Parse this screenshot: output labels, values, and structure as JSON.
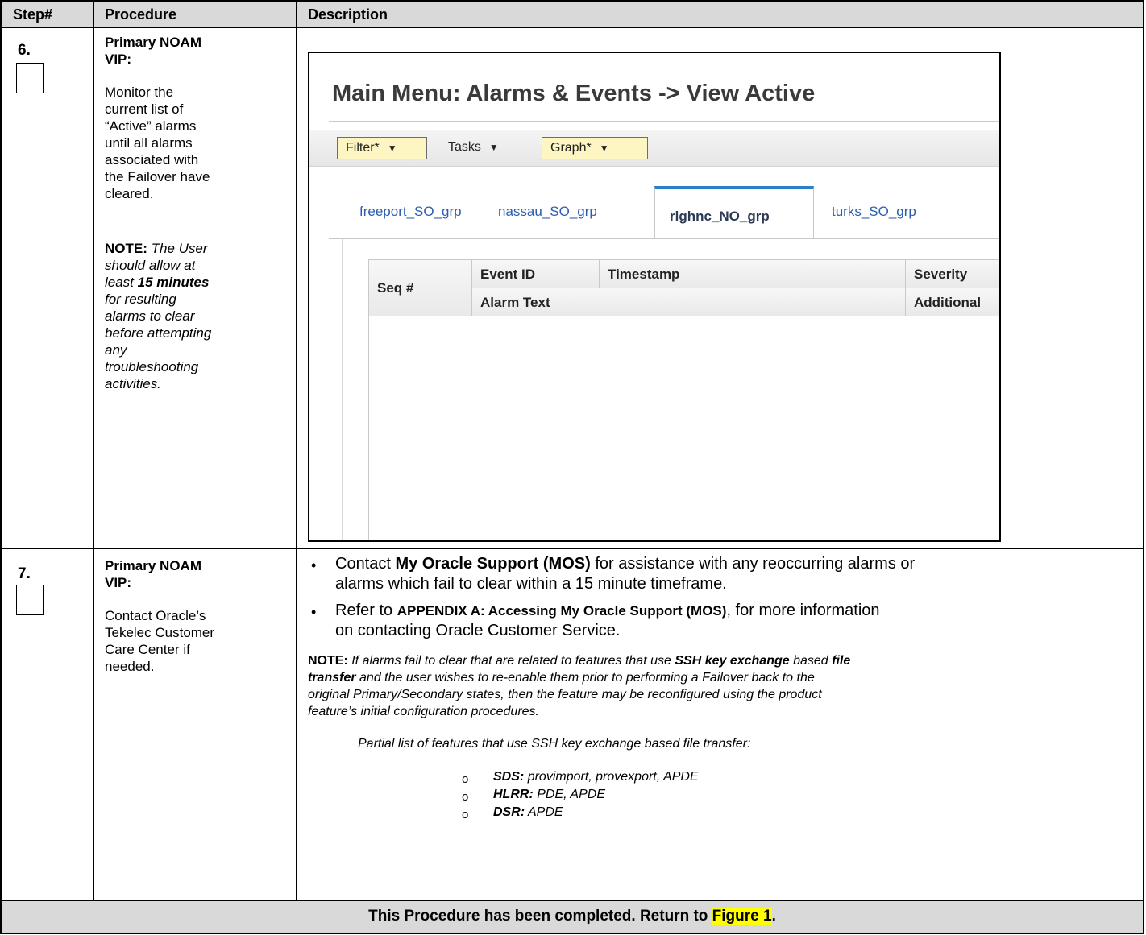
{
  "table": {
    "headers": {
      "step": "Step#",
      "procedure": "Procedure",
      "description": "Description"
    }
  },
  "step6": {
    "number": "6.",
    "location": "Primary NOAM VIP:",
    "instruction": "Monitor the current list of “Active” alarms until all alarms associated with the Failover have cleared.",
    "note_label": "NOTE:",
    "note_part1": "The User should allow at least",
    "note_emph": "15 minutes",
    "note_part2": "for resulting alarms to clear before attempting any troubleshooting activities.",
    "screenshot": {
      "title": "Main Menu: Alarms & Events -> View Active",
      "toolbar": {
        "filter": "Filter*",
        "tasks": "Tasks",
        "graph": "Graph*"
      },
      "tabs": [
        "freeport_SO_grp",
        "nassau_SO_grp",
        "rlghnc_NO_grp",
        "turks_SO_grp"
      ],
      "active_tab": "rlghnc_NO_grp",
      "columns": {
        "seq": "Seq #",
        "event_id": "Event ID",
        "timestamp": "Timestamp",
        "severity": "Severity",
        "alarm_text": "Alarm Text",
        "additional": "Additional"
      }
    }
  },
  "step7": {
    "number": "7.",
    "location": "Primary NOAM VIP:",
    "instruction": "Contact Oracle’s Tekelec Customer Care Center if needed.",
    "bullet1_pre": "Contact",
    "bullet1_bold": "My Oracle Support (MOS)",
    "bullet1_post": "for assistance with any reoccurring alarms or",
    "bullet1_line2": "alarms which fail to clear within a 15 minute timeframe.",
    "bullet2_pre": "Refer to",
    "bullet2_bold": "APPENDIX A: Accessing My Oracle Support (MOS)",
    "bullet2_post": ", for more information",
    "bullet2_line2": "on contacting Oracle Customer Service.",
    "note_label": "NOTE:",
    "note_a": "If alarms fail to clear that are related to features that use",
    "note_b": "SSH key exchange",
    "note_c": "based",
    "note_d": "file",
    "note_e": "transfer",
    "note_f": "and the user wishes to re-enable them prior to performing a Failover back to the",
    "note_line3": "original Primary/Secondary states, then the feature may be reconfigured using the product",
    "note_line4": "feature’s initial configuration procedures.",
    "partial_list_intro": "Partial list of features that use SSH key exchange based file transfer:",
    "features": [
      {
        "name": "SDS:",
        "items": "provimport, provexport, APDE"
      },
      {
        "name": "HLRR:",
        "items": "PDE, APDE"
      },
      {
        "name": "DSR:",
        "items": "APDE"
      }
    ]
  },
  "footer": {
    "text": "This Procedure has been completed.  Return to",
    "link": "Figure 1",
    "end": "."
  }
}
